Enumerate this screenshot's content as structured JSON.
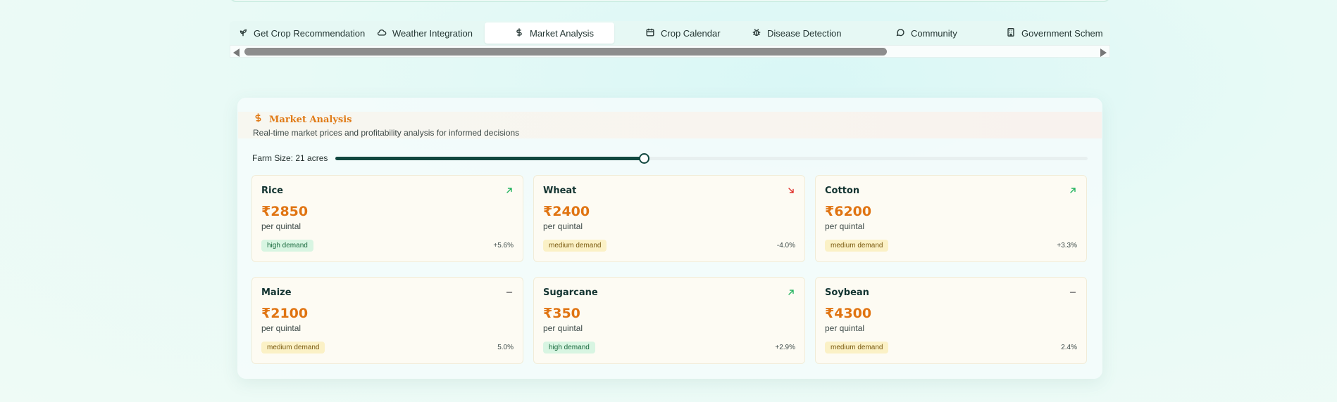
{
  "tabs": [
    {
      "label": "Get Crop Recommendation",
      "icon": "sprout-icon"
    },
    {
      "label": "Weather Integration",
      "icon": "cloud-icon"
    },
    {
      "label": "Market Analysis",
      "icon": "dollar-icon",
      "active": true
    },
    {
      "label": "Crop Calendar",
      "icon": "calendar-icon"
    },
    {
      "label": "Disease Detection",
      "icon": "bug-icon"
    },
    {
      "label": "Community",
      "icon": "chat-icon"
    },
    {
      "label": "Government Schem",
      "icon": "building-icon"
    }
  ],
  "market": {
    "title": "Market Analysis",
    "icon": "dollar-icon",
    "subtitle": "Real-time market prices and profitability analysis for informed decisions",
    "farm_size_label": "Farm Size: 21 acres",
    "farm_size_fraction": 0.41,
    "crops": [
      {
        "name": "Rice",
        "price": "₹2850",
        "unit": "per quintal",
        "demand": "high demand",
        "demand_level": "high",
        "change": "+5.6%",
        "trend": "up"
      },
      {
        "name": "Wheat",
        "price": "₹2400",
        "unit": "per quintal",
        "demand": "medium demand",
        "demand_level": "medium",
        "change": "-4.0%",
        "trend": "down"
      },
      {
        "name": "Cotton",
        "price": "₹6200",
        "unit": "per quintal",
        "demand": "medium demand",
        "demand_level": "medium",
        "change": "+3.3%",
        "trend": "up"
      },
      {
        "name": "Maize",
        "price": "₹2100",
        "unit": "per quintal",
        "demand": "medium demand",
        "demand_level": "medium",
        "change": "5.0%",
        "trend": "flat"
      },
      {
        "name": "Sugarcane",
        "price": "₹350",
        "unit": "per quintal",
        "demand": "high demand",
        "demand_level": "high",
        "change": "+2.9%",
        "trend": "up"
      },
      {
        "name": "Soybean",
        "price": "₹4300",
        "unit": "per quintal",
        "demand": "medium demand",
        "demand_level": "medium",
        "change": "2.4%",
        "trend": "flat"
      }
    ]
  },
  "colors": {
    "accent_orange": "#e07a16",
    "trend_up": "#22b35e",
    "trend_down": "#e0302a",
    "trend_flat": "#6b6b6b",
    "slider": "#124840"
  }
}
